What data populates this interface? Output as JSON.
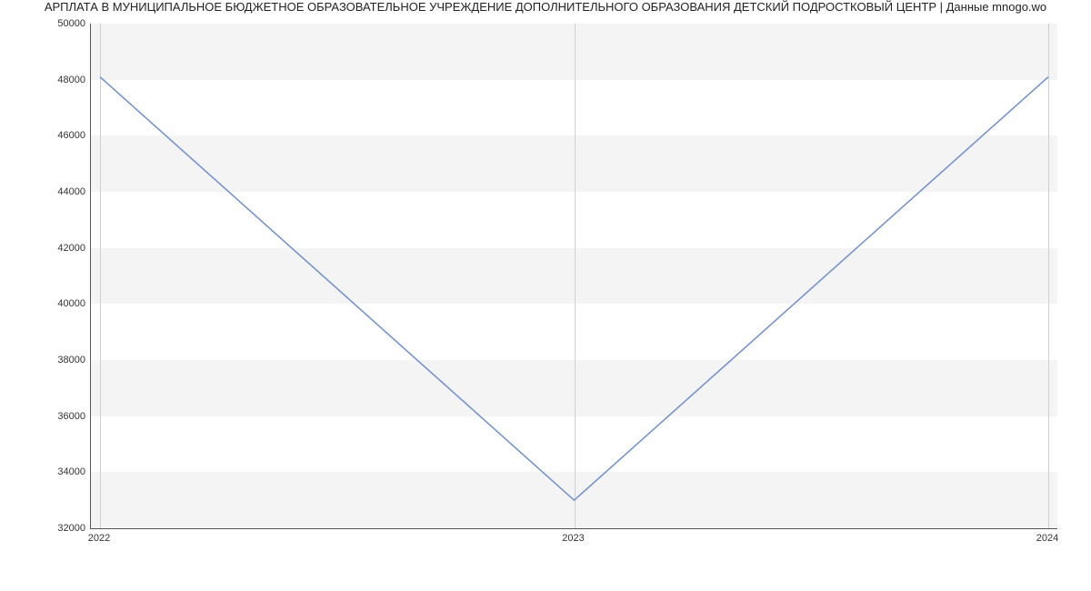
{
  "chart_data": {
    "type": "line",
    "title": "АРПЛАТА В МУНИЦИПАЛЬНОЕ БЮДЖЕТНОЕ ОБРАЗОВАТЕЛЬНОЕ УЧРЕЖДЕНИЕ ДОПОЛНИТЕЛЬНОГО ОБРАЗОВАНИЯ ДЕТСКИЙ ПОДРОСТКОВЫЙ ЦЕНТР | Данные mnogo.wo",
    "categories": [
      "2022",
      "2023",
      "2024"
    ],
    "values": [
      48100,
      33000,
      48100
    ],
    "xlabel": "",
    "ylabel": "",
    "ylim": [
      32000,
      50000
    ],
    "yticks": [
      32000,
      34000,
      36000,
      38000,
      40000,
      42000,
      44000,
      46000,
      48000,
      50000
    ],
    "xticks": [
      "2022",
      "2023",
      "2024"
    ],
    "colors": {
      "line": "#6b8fd6",
      "band": "#f4f4f4",
      "axis": "#555555"
    }
  }
}
